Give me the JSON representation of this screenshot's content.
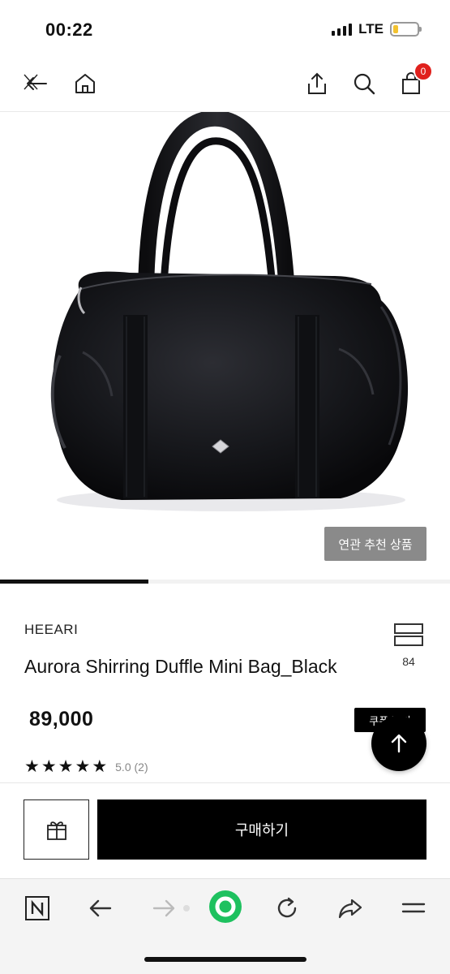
{
  "status_bar": {
    "time": "00:22",
    "network": "LTE"
  },
  "nav": {
    "cart_count": "0"
  },
  "hero": {
    "related_button": "연관 추천 상품",
    "carousel_progress": 0.33
  },
  "product": {
    "brand": "HEEARI",
    "title": "Aurora Shirring Duffle Mini Bag_Black",
    "like_count": "84",
    "price": "89,000",
    "coupon_label": "쿠폰 받기",
    "rating_stars": 5,
    "rating_text": "5.0 (2)"
  },
  "actions": {
    "buy_label": "구매하기"
  },
  "icons": {
    "close": "close-icon",
    "back": "back-arrow-icon",
    "home": "home-icon",
    "share": "share-icon",
    "search": "search-icon",
    "cart": "shopping-bag-icon",
    "gift": "gift-icon",
    "top": "arrow-up-icon",
    "like": "bookmark-icon",
    "browser_logo": "n-logo-icon",
    "browser_back": "arrow-left-icon",
    "browser_forward": "arrow-right-icon",
    "browser_home": "green-circle-icon",
    "refresh": "refresh-icon",
    "browser_share": "forward-share-icon",
    "menu": "menu-icon"
  },
  "colors": {
    "badge": "#e0211d",
    "browser_accent": "#1ec15f",
    "button": "#000000",
    "related_button": "#8a8a8a"
  }
}
